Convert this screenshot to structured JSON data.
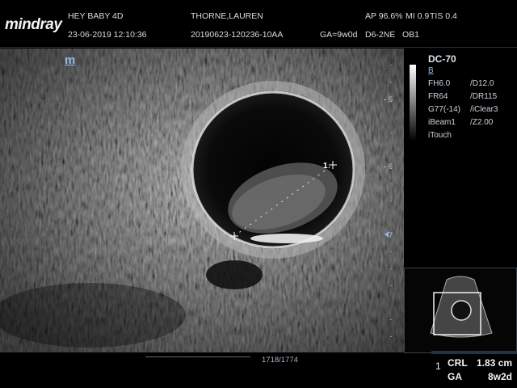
{
  "header": {
    "brand": "mindray",
    "app": "HEY BABY 4D",
    "datetime": "23-06-2019 12:10:36",
    "patient": "THORNE,LAUREN",
    "exam_id": "20190623-120236-10AA",
    "ga": "GA=9w0d",
    "probe_preset": "D6-2NE",
    "ob": "OB1",
    "power": "AP 96.6%",
    "mi": "MI 0.9",
    "tis": "TIS 0.4"
  },
  "side": {
    "probe": "DC-70",
    "mode": "B",
    "params_left": [
      "FH6.0",
      "FR64",
      "G77(-14)",
      "iBeam1",
      "iTouch"
    ],
    "params_right": [
      "/D12.0",
      "/DR115",
      "/iClear3",
      "/Z2.00"
    ]
  },
  "image": {
    "marker": "m",
    "depth_labels": [
      "5",
      "6",
      "7"
    ],
    "cursor_1": "1",
    "cine_frames": "1718/1774"
  },
  "measurement": {
    "index": "1",
    "rows": [
      {
        "label": "CRL",
        "value": "1.83 cm"
      },
      {
        "label": "GA",
        "value": "8w2d"
      }
    ]
  }
}
